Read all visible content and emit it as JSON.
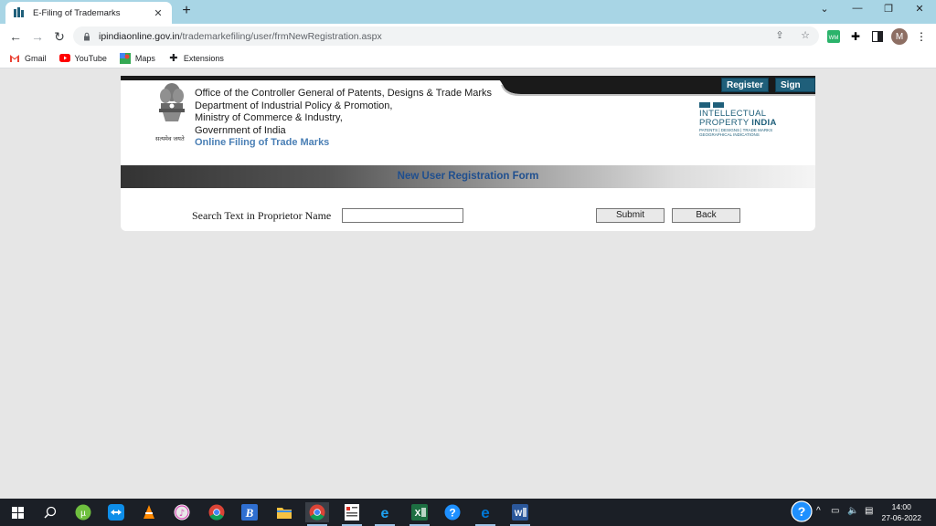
{
  "browser": {
    "tab_title": "E-Filing of Trademarks",
    "url_host": "ipindiaonline.gov.in",
    "url_path": "/trademarkefiling/user/frmNewRegistration.aspx",
    "profile_initial": "M"
  },
  "bookmarks": [
    {
      "label": "Gmail",
      "icon": "gmail-icon"
    },
    {
      "label": "YouTube",
      "icon": "youtube-icon"
    },
    {
      "label": "Maps",
      "icon": "maps-icon"
    },
    {
      "label": "Extensions",
      "icon": "puzzle-icon"
    }
  ],
  "header": {
    "register_label": "Register",
    "signin_label": "Sign In",
    "org_lines": [
      "Office of the Controller General of Patents, Designs & Trade Marks",
      "Department of Industrial Policy & Promotion,",
      "Ministry of Commerce & Industry,",
      "Government of India"
    ],
    "emblem_motto": "सत्यमेव जयते",
    "online_filing": "Online Filing of Trade Marks",
    "ipi_line1": "INTELLECTUAL",
    "ipi_line2a": "PROPERTY ",
    "ipi_line2b": "INDIA",
    "ipi_small1": "PATENTS | DESIGNS | TRADE MARKS",
    "ipi_small2": "GEOGRAPHICAL INDICATIONS"
  },
  "form": {
    "title": "New User Registration Form",
    "search_label": "Search Text in Proprietor Name",
    "search_value": "",
    "submit_label": "Submit",
    "back_label": "Back"
  },
  "taskbar": {
    "time": "14:00",
    "date": "27-06-2022"
  },
  "colors": {
    "tabstrip": "#a8d5e5",
    "accent_blue": "#1f5f7a",
    "form_title": "#1f4f8f"
  }
}
